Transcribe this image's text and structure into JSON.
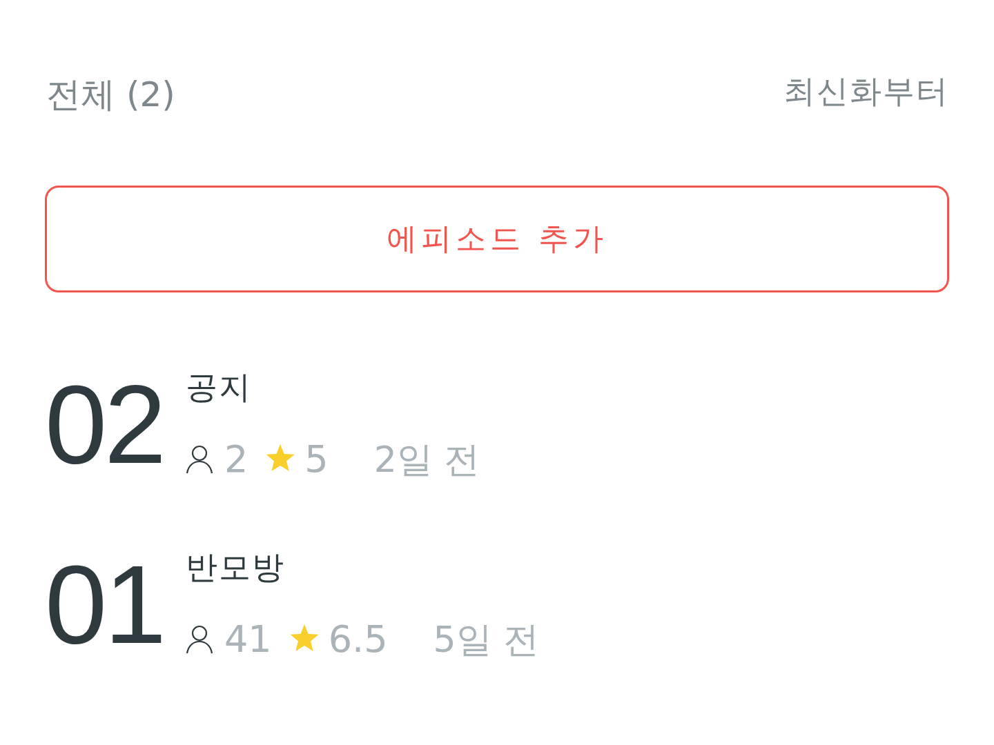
{
  "header": {
    "total_label": "전체 (2)",
    "sort_label": "최신화부터"
  },
  "add_button": {
    "label": "에피소드 추가"
  },
  "episodes": [
    {
      "number": "02",
      "title": "공지",
      "viewers": "2",
      "rating": "5",
      "date": "2일 전"
    },
    {
      "number": "01",
      "title": "반모방",
      "viewers": "41",
      "rating": "6.5",
      "date": "5일 전"
    }
  ]
}
